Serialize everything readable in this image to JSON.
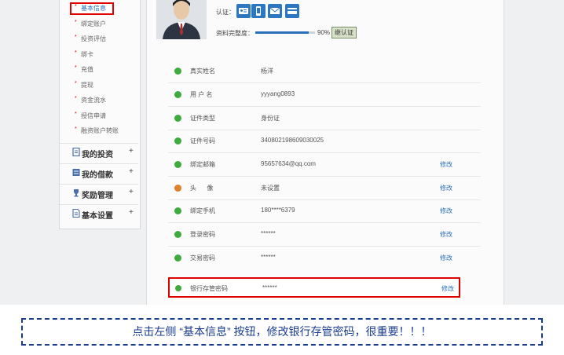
{
  "sidebar": {
    "sub_items": [
      "基本信息",
      "绑定账户",
      "投资评估",
      "绑卡",
      "充值",
      "提现",
      "资金流水",
      "授信申请",
      "融资账户转账"
    ],
    "sections": [
      {
        "label": "我的投资",
        "icon": "document-icon"
      },
      {
        "label": "我的借款",
        "icon": "list-icon"
      },
      {
        "label": "奖励管理",
        "icon": "trophy-icon"
      },
      {
        "label": "基本设置",
        "icon": "settings-doc-icon"
      }
    ],
    "plus": "+"
  },
  "profile": {
    "cert_label": "认证：",
    "cert_icons": [
      "id-card-icon",
      "phone-icon",
      "mail-icon",
      "bank-card-icon"
    ],
    "progress_label": "资料完整度：",
    "progress_value": "90%",
    "progress_fraction": 0.9,
    "progress_button": "继认证"
  },
  "info_rows": [
    {
      "label": "真实姓名",
      "value": "杨洋",
      "action": "",
      "status": "ok"
    },
    {
      "label": "用 户 名",
      "value": "yyyang0893",
      "action": "",
      "status": "ok"
    },
    {
      "label": "证件类型",
      "value": "身份证",
      "action": "",
      "status": "ok"
    },
    {
      "label": "证件号码",
      "value": "340802198609030025",
      "action": "",
      "status": "ok"
    },
    {
      "label": "绑定邮箱",
      "value": "95657634@qq.com",
      "action": "修改",
      "status": "ok"
    },
    {
      "label": "头      像",
      "value": "未设置",
      "action": "修改",
      "status": "warn"
    },
    {
      "label": "绑定手机",
      "value": "180****6379",
      "action": "修改",
      "status": "ok"
    },
    {
      "label": "登录密码",
      "value": "******",
      "action": "修改",
      "status": "ok"
    },
    {
      "label": "交易密码",
      "value": "******",
      "action": "修改",
      "status": "ok"
    }
  ],
  "highlight_row": {
    "label": "银行存管密码",
    "value": "******",
    "action": "修改"
  },
  "notice": "点击左侧 “基本信息” 按钮，修改银行存管密码，很重要！！！",
  "colors": {
    "highlight": "#e00000",
    "accent": "#2a6fba",
    "notice": "#1a3c8e",
    "ok": "#3dac3d",
    "warn": "#e0802a"
  }
}
